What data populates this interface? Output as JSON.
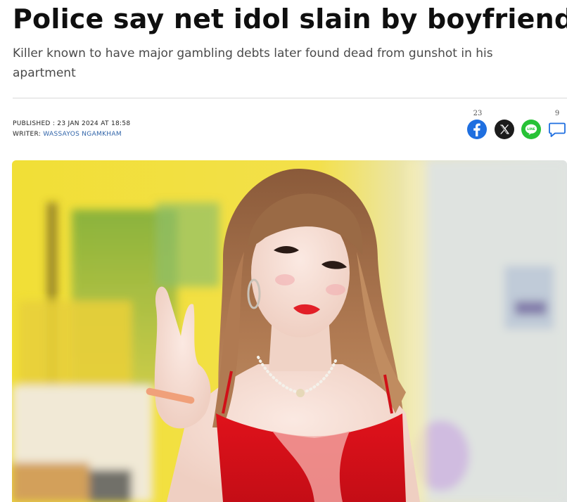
{
  "article": {
    "headline": "Police say net idol slain by boyfriend",
    "subheadline": "Killer known to have major gambling debts later found dead from gunshot in his apartment",
    "published_label": "PUBLISHED : 23 JAN 2024 AT 18:58",
    "writer_label": "WRITER:",
    "writer_name": "WASSAYOS NGAMKHAM"
  },
  "share": {
    "facebook_count": "23",
    "comment_count": "9",
    "icons": [
      "facebook-icon",
      "x-icon",
      "line-icon",
      "comment-icon"
    ],
    "line_text": "LINE",
    "colors": {
      "facebook": "#1f6fe0",
      "x": "#1c1c1c",
      "line": "#27c236",
      "comment": "#1f6fe0"
    }
  },
  "image": {
    "subject": "woman in red dress",
    "icon": "photo"
  }
}
